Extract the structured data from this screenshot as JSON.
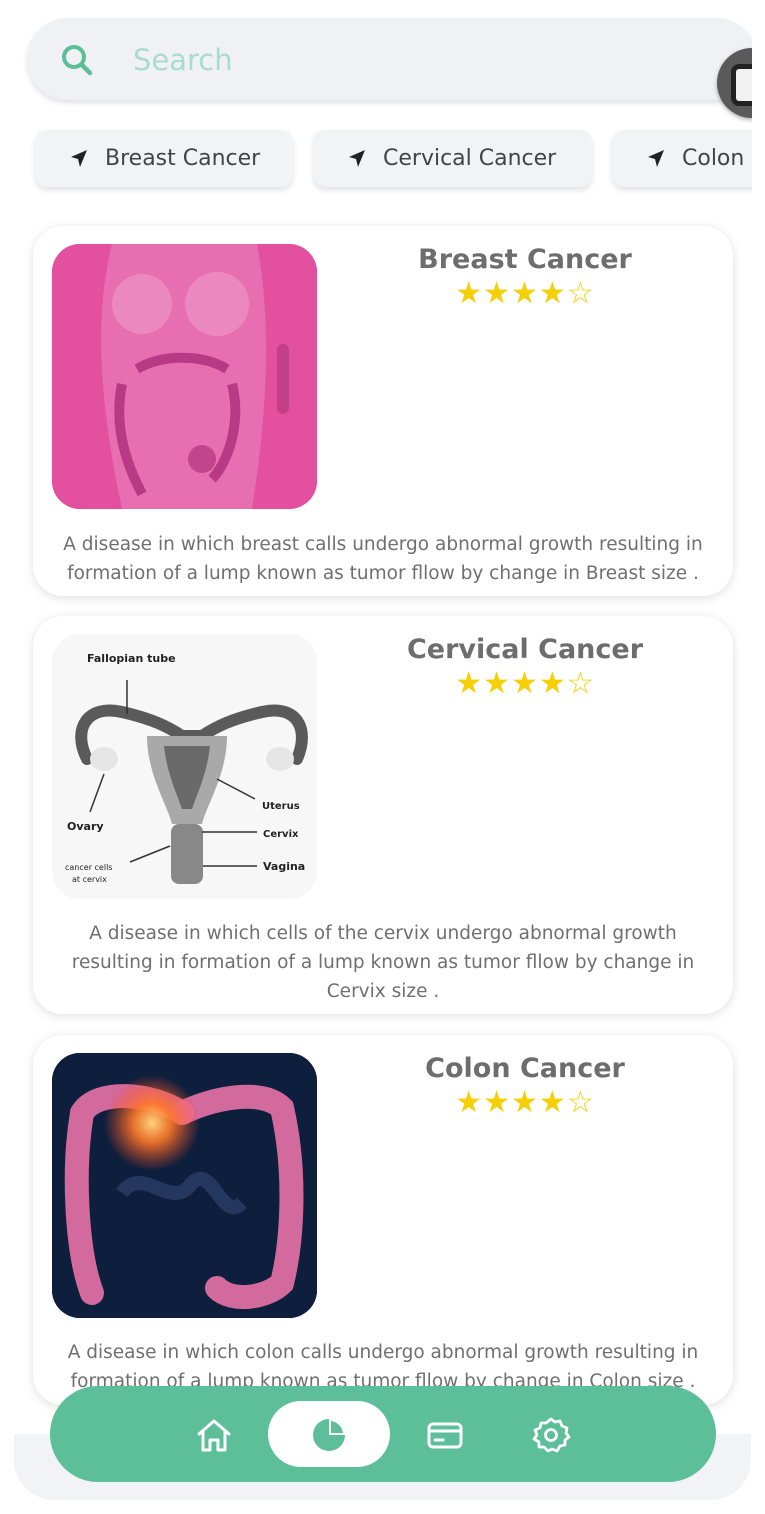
{
  "search": {
    "placeholder": "Search"
  },
  "chips": [
    {
      "label": "Breast Cancer"
    },
    {
      "label": "Cervical Cancer"
    },
    {
      "label": "Colon Cancer"
    }
  ],
  "cards": [
    {
      "title": "Breast Cancer",
      "rating": 4,
      "rating_max": 5,
      "description": "A disease in which breast calls undergo abnormal growth resulting in formation of a lump known as tumor fllow by change in Breast size ."
    },
    {
      "title": "Cervical Cancer",
      "rating": 4,
      "rating_max": 5,
      "description": "A disease in which cells of the cervix undergo abnormal growth resulting in formation of a lump known as tumor fllow by change in Cervix size .",
      "diagram_labels": {
        "fallopian": "Fallopian tube",
        "uterus": "Uterus",
        "ovary": "Ovary",
        "cervix": "Cervix",
        "cancer_cells_1": "cancer cells",
        "cancer_cells_2": "at cervix",
        "vagina": "Vagina"
      }
    },
    {
      "title": "Colon Cancer",
      "rating": 4,
      "rating_max": 5,
      "description": "A disease in which colon calls undergo abnormal growth resulting in formation of a lump known as tumor fllow by change in Colon size ."
    }
  ],
  "nav": {
    "items": [
      {
        "icon": "home-icon"
      },
      {
        "icon": "pie-chart-icon",
        "active": true
      },
      {
        "icon": "credit-card-icon"
      },
      {
        "icon": "settings-gear-icon"
      }
    ]
  },
  "colors": {
    "accent": "#5cbf99",
    "star": "#f5cf07",
    "search_bg": "#eff1f4",
    "placeholder": "#a9dccd"
  }
}
